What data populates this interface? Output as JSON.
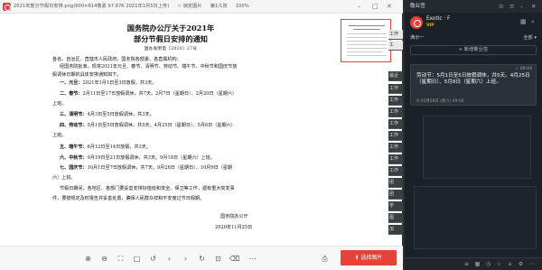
{
  "viewer": {
    "title": "2021年部分节假日安排.png(600×814像素 97.87K 2021年1月5日上传)",
    "pin_label": "锁定图片",
    "page_label": "第1/1张",
    "zoom": "100%"
  },
  "document": {
    "title_line1": "国务院办公厅关于2021年",
    "title_line2": "部分节假日安排的通知",
    "ref_no": "国办发明电〔2020〕27号",
    "addressee": "各省、自治区、直辖市人民政府，国务院各部委、各直属机构：",
    "intro1": "经国务院批准，现将2021年元旦、春节、清明节、劳动节、端午节、中秋节和国庆节放",
    "intro2": "假调休日期的具体安排通知如下。",
    "items": [
      {
        "head": "一、元旦：",
        "text": "2021年1月1日至3日放假，共3天。"
      },
      {
        "head": "二、春节：",
        "text": "2月11日至17日放假调休，共7天。2月7日（星期日）、2月20日（星期六）"
      },
      {
        "head": "",
        "text": "上班。"
      },
      {
        "head": "三、清明节：",
        "text": "4月3日至5日放假调休，共3天。"
      },
      {
        "head": "四、劳动节：",
        "text": "5月1日至5日放假调休，共5天。4月25日（星期日）、5月8日（星期六）"
      },
      {
        "head": "",
        "text": "上班。"
      },
      {
        "head": "五、端午节：",
        "text": "6月12日至14日放假，共3天。"
      },
      {
        "head": "六、中秋节：",
        "text": "9月19日至21日放假调休，共3天。9月18日（星期六）上班。"
      },
      {
        "head": "七、国庆节：",
        "text": "10月1日至7日放假调休，共7天。9月26日（星期日）、10月9日（星期"
      },
      {
        "head": "",
        "text": "六）上班。"
      }
    ],
    "closing1": "节假日期间，各地区、各部门要妥善安排好值班和安全、保卫等工作，遇有重大突发事",
    "closing2": "件，要按规定及时报告并妥善处置，确保人民群众祥和平安度过节日假期。",
    "signature": "国务院办公厅",
    "date": "2020年11月25日"
  },
  "toolbar": {
    "select_button": "选择图片"
  },
  "side_tabs": [
    "工作",
    "工",
    "最近",
    "工作",
    "工作",
    "工作",
    "工作",
    "工作",
    "工作",
    "工作",
    "工作",
    "团",
    "团",
    "学",
    "图",
    "加"
  ],
  "notes_panel": {
    "title": "敬业签",
    "username": "Exotic · F",
    "vip": "VIP",
    "filter_label": "满示一",
    "filter_right": "全部",
    "new_button": "+ 新增敬业签",
    "card": {
      "time": "09:04",
      "text": "劳动节：5月1日至5日放假调休，共5天。4月25日（星期日）、5月8日（星期六）上班。",
      "meta": "05月08日 (周六) 09:00"
    }
  },
  "colors": {
    "accent_red": "#e8403a",
    "notes_bg": "#1b2128",
    "card_bg": "#2a3138"
  }
}
